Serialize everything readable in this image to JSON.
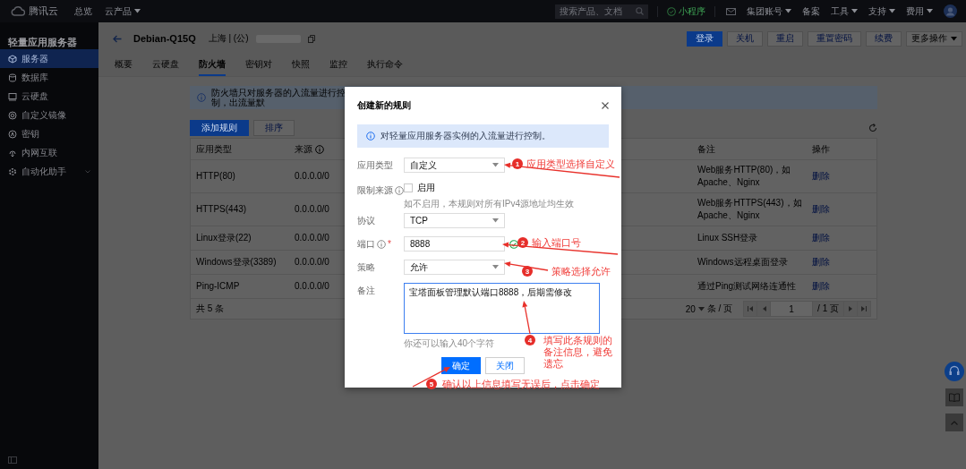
{
  "topbar": {
    "logo": "腾讯云",
    "nav": [
      {
        "label": "总览",
        "dropdown": false
      },
      {
        "label": "云产品",
        "dropdown": true
      }
    ],
    "search": {
      "placeholder": "搜索产品、文档"
    },
    "mini_program": "小程序",
    "menu": [
      {
        "label": "集团账号",
        "dropdown": true
      },
      {
        "label": "备案",
        "dropdown": false
      },
      {
        "label": "工具",
        "dropdown": true
      },
      {
        "label": "支持",
        "dropdown": true
      },
      {
        "label": "费用",
        "dropdown": true
      }
    ]
  },
  "sidebar": {
    "title": "轻量应用服务器",
    "items": [
      {
        "label": "服务器",
        "kind": "link",
        "selected": true
      },
      {
        "label": "数据库",
        "kind": "link",
        "selected": false
      },
      {
        "label": "云硬盘",
        "kind": "link",
        "selected": false
      },
      {
        "label": "自定义镜像",
        "kind": "link",
        "selected": false
      },
      {
        "label": "密钥",
        "kind": "link",
        "selected": false
      },
      {
        "label": "内网互联",
        "kind": "link",
        "selected": false
      },
      {
        "label": "自动化助手",
        "kind": "group",
        "selected": false
      }
    ]
  },
  "instance": {
    "title": "Debian-Q15Q",
    "region": "上海 | (公)",
    "actions": [
      {
        "label": "登录",
        "primary": true,
        "dropdown": false
      },
      {
        "label": "关机",
        "primary": false,
        "dropdown": false
      },
      {
        "label": "重启",
        "primary": false,
        "dropdown": false
      },
      {
        "label": "重置密码",
        "primary": false,
        "dropdown": false
      },
      {
        "label": "续费",
        "primary": false,
        "dropdown": false
      },
      {
        "label": "更多操作",
        "primary": false,
        "dropdown": true
      }
    ]
  },
  "tabs": [
    {
      "label": "概要",
      "selected": false
    },
    {
      "label": "云硬盘",
      "selected": false
    },
    {
      "label": "防火墙",
      "selected": true
    },
    {
      "label": "密钥对",
      "selected": false
    },
    {
      "label": "快照",
      "selected": false
    },
    {
      "label": "监控",
      "selected": false
    },
    {
      "label": "执行命令",
      "selected": false
    }
  ],
  "firewall": {
    "notice": "防火墙只对服务器的入流量进行控制，出流量默",
    "buttons": [
      {
        "label": "添加规则",
        "primary": true
      },
      {
        "label": "排序",
        "primary": false
      }
    ],
    "table": {
      "columns": [
        {
          "label": "应用类型",
          "info": false
        },
        {
          "label": "来源",
          "info": true
        },
        {
          "label": "备注",
          "info": false
        },
        {
          "label": "操作",
          "info": false
        }
      ],
      "rows": [
        {
          "app_type": "HTTP(80)",
          "source": "0.0.0.0/0",
          "remark": "Web服务HTTP(80)，如Apache、Nginx",
          "action": "删除"
        },
        {
          "app_type": "HTTPS(443)",
          "source": "0.0.0.0/0",
          "remark": "Web服务HTTPS(443)，如Apache、Nginx",
          "action": "删除"
        },
        {
          "app_type": "Linux登录(22)",
          "source": "0.0.0.0/0",
          "remark": "Linux SSH登录",
          "action": "删除"
        },
        {
          "app_type": "Windows登录(3389)",
          "source": "0.0.0.0/0",
          "remark": "Windows远程桌面登录",
          "action": "删除"
        },
        {
          "app_type": "Ping-ICMP",
          "source": "0.0.0.0/0",
          "remark": "通过Ping测试网络连通性",
          "action": "删除"
        }
      ]
    },
    "total": "共 5 条",
    "pagination": {
      "page_size": "20",
      "per_page": "条 / 页",
      "page": "1",
      "pages": "/ 1 页"
    }
  },
  "dialog": {
    "title": "创建新的规则",
    "notice": "对轻量应用服务器实例的入流量进行控制。",
    "fields": [
      {
        "kind": "select",
        "label": "应用类型",
        "info": false,
        "value": "自定义"
      },
      {
        "kind": "checkbox",
        "label": "限制来源",
        "info": true,
        "option": "启用",
        "checked": false,
        "hint": "如不启用，本规则对所有IPv4源地址均生效"
      },
      {
        "kind": "select",
        "label": "协议",
        "info": false,
        "value": "TCP"
      },
      {
        "kind": "input",
        "label": "端口",
        "info": true,
        "required_mark": "*",
        "value": "8888"
      },
      {
        "kind": "select",
        "label": "策略",
        "info": false,
        "value": "允许"
      },
      {
        "kind": "textarea",
        "label": "备注",
        "info": false,
        "value": "宝塔面板管理默认端口8888，后期需修改",
        "hint": "你还可以输入40个字符"
      }
    ],
    "buttons": [
      {
        "label": "确定",
        "primary": true
      },
      {
        "label": "关闭",
        "primary": false
      }
    ]
  },
  "annotations": [
    {
      "number": "1",
      "text": "应用类型选择自定义"
    },
    {
      "number": "2",
      "text": "输入端口号"
    },
    {
      "number": "3",
      "text": "策略选择允许"
    },
    {
      "number": "4",
      "text": "填写此条规则的备注信息，避免遗忘"
    },
    {
      "number": "5",
      "text": "确认以上信息填写无误后，点击确定"
    }
  ]
}
